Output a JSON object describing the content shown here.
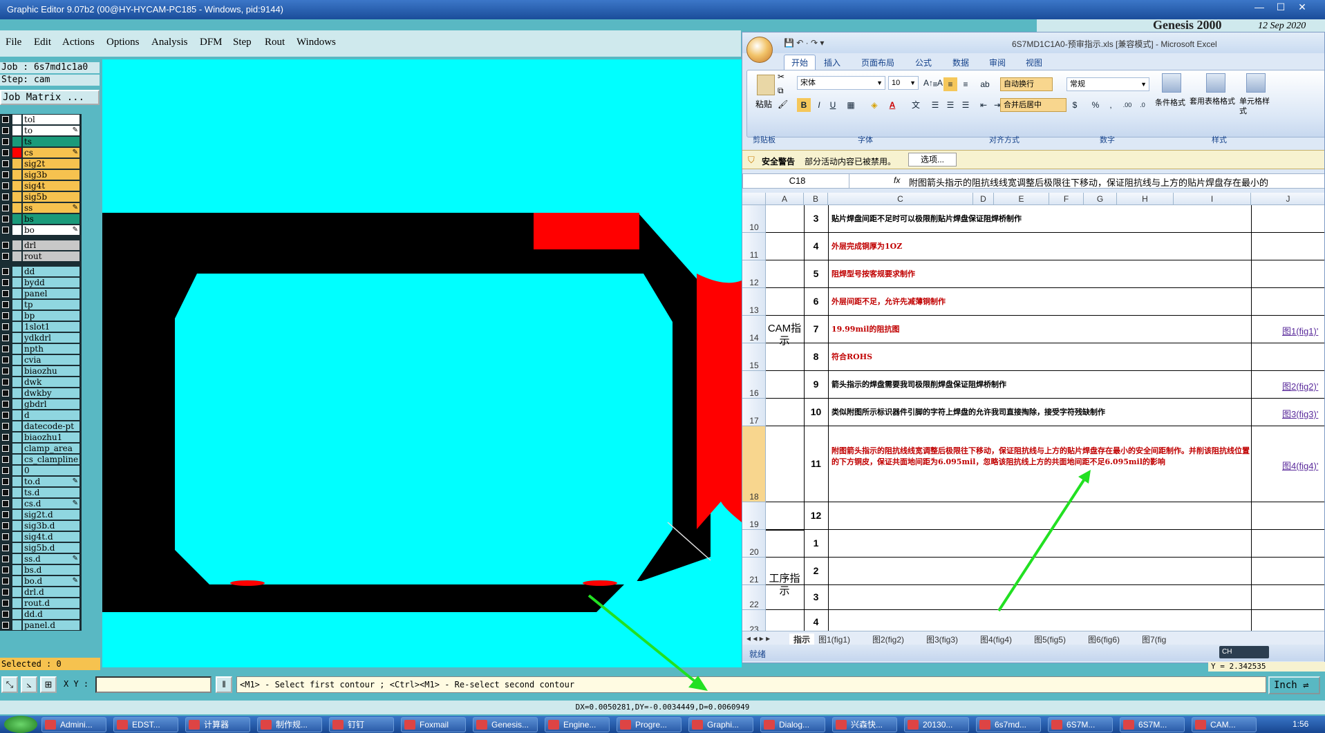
{
  "title_bar": {
    "title": "Graphic Editor 9.07b2 (00@HY-HYCAM-PC185 - Windows, pid:9144)"
  },
  "genesis": {
    "brand": "Genesis 2000",
    "date": "12 Sep 2020"
  },
  "menu": [
    "File",
    "Edit",
    "Actions",
    "Options",
    "Analysis",
    "DFM",
    "Step",
    "Rout",
    "Windows"
  ],
  "job": {
    "job_line": "Job : 6s7md1c1a0",
    "step_line": "Step: cam",
    "matrix_button": "Job Matrix ..."
  },
  "layers": [
    {
      "name": "tol",
      "color": "#ffffff",
      "bg": "#ffffff",
      "mark": ""
    },
    {
      "name": "to",
      "color": "#ffffff",
      "bg": "#ffffff",
      "mark": "✎"
    },
    {
      "name": "ts",
      "color": "#1a9a7a",
      "bg": "#1a9a7a",
      "mark": ""
    },
    {
      "name": "cs",
      "color": "#ff0000",
      "bg": "#f6c24f",
      "mark": "✎"
    },
    {
      "name": "sig2t",
      "color": "#f6c24f",
      "bg": "#f6c24f",
      "mark": ""
    },
    {
      "name": "sig3b",
      "color": "#f6c24f",
      "bg": "#f6c24f",
      "mark": ""
    },
    {
      "name": "sig4t",
      "color": "#f6c24f",
      "bg": "#f6c24f",
      "mark": ""
    },
    {
      "name": "sig5b",
      "color": "#f6c24f",
      "bg": "#f6c24f",
      "mark": ""
    },
    {
      "name": "ss",
      "color": "#f6c24f",
      "bg": "#f6c24f",
      "mark": "✎"
    },
    {
      "name": "bs",
      "color": "#1a9a7a",
      "bg": "#1a9a7a",
      "mark": ""
    },
    {
      "name": "bo",
      "color": "#ffffff",
      "bg": "#ffffff",
      "mark": "✎"
    },
    {
      "name": "drl",
      "color": "#c8c8c8",
      "bg": "#c8c8c8",
      "mark": ""
    },
    {
      "name": "rout",
      "color": "#c8c8c8",
      "bg": "#c8c8c8",
      "mark": ""
    },
    {
      "name": "dd",
      "color": "#8fd6e0",
      "bg": "#8fd6e0",
      "mark": ""
    },
    {
      "name": "bydd",
      "color": "#8fd6e0",
      "bg": "#8fd6e0",
      "mark": ""
    },
    {
      "name": "panel",
      "color": "#8fd6e0",
      "bg": "#8fd6e0",
      "mark": ""
    },
    {
      "name": "tp",
      "color": "#8fd6e0",
      "bg": "#8fd6e0",
      "mark": ""
    },
    {
      "name": "bp",
      "color": "#8fd6e0",
      "bg": "#8fd6e0",
      "mark": ""
    },
    {
      "name": "1slot1",
      "color": "#8fd6e0",
      "bg": "#8fd6e0",
      "mark": ""
    },
    {
      "name": "ydkdrl",
      "color": "#8fd6e0",
      "bg": "#8fd6e0",
      "mark": ""
    },
    {
      "name": "npth",
      "color": "#8fd6e0",
      "bg": "#8fd6e0",
      "mark": ""
    },
    {
      "name": "cvia",
      "color": "#8fd6e0",
      "bg": "#8fd6e0",
      "mark": ""
    },
    {
      "name": "biaozhu",
      "color": "#8fd6e0",
      "bg": "#8fd6e0",
      "mark": ""
    },
    {
      "name": "dwk",
      "color": "#8fd6e0",
      "bg": "#8fd6e0",
      "mark": ""
    },
    {
      "name": "dwkby",
      "color": "#8fd6e0",
      "bg": "#8fd6e0",
      "mark": ""
    },
    {
      "name": "gbdrl",
      "color": "#8fd6e0",
      "bg": "#8fd6e0",
      "mark": ""
    },
    {
      "name": "d",
      "color": "#8fd6e0",
      "bg": "#8fd6e0",
      "mark": ""
    },
    {
      "name": "datecode-pt",
      "color": "#8fd6e0",
      "bg": "#8fd6e0",
      "mark": ""
    },
    {
      "name": "biaozhu1",
      "color": "#8fd6e0",
      "bg": "#8fd6e0",
      "mark": ""
    },
    {
      "name": "clamp_area",
      "color": "#8fd6e0",
      "bg": "#8fd6e0",
      "mark": ""
    },
    {
      "name": "cs_clampline",
      "color": "#8fd6e0",
      "bg": "#8fd6e0",
      "mark": ""
    },
    {
      "name": "0",
      "color": "#8fd6e0",
      "bg": "#8fd6e0",
      "mark": ""
    },
    {
      "name": "to.d",
      "color": "#8fd6e0",
      "bg": "#8fd6e0",
      "mark": "✎"
    },
    {
      "name": "ts.d",
      "color": "#8fd6e0",
      "bg": "#8fd6e0",
      "mark": ""
    },
    {
      "name": "cs.d",
      "color": "#8fd6e0",
      "bg": "#8fd6e0",
      "mark": "✎"
    },
    {
      "name": "sig2t.d",
      "color": "#8fd6e0",
      "bg": "#8fd6e0",
      "mark": ""
    },
    {
      "name": "sig3b.d",
      "color": "#8fd6e0",
      "bg": "#8fd6e0",
      "mark": ""
    },
    {
      "name": "sig4t.d",
      "color": "#8fd6e0",
      "bg": "#8fd6e0",
      "mark": ""
    },
    {
      "name": "sig5b.d",
      "color": "#8fd6e0",
      "bg": "#8fd6e0",
      "mark": ""
    },
    {
      "name": "ss.d",
      "color": "#8fd6e0",
      "bg": "#8fd6e0",
      "mark": "✎"
    },
    {
      "name": "bs.d",
      "color": "#8fd6e0",
      "bg": "#8fd6e0",
      "mark": ""
    },
    {
      "name": "bo.d",
      "color": "#8fd6e0",
      "bg": "#8fd6e0",
      "mark": "✎"
    },
    {
      "name": "drl.d",
      "color": "#8fd6e0",
      "bg": "#8fd6e0",
      "mark": ""
    },
    {
      "name": "rout.d",
      "color": "#8fd6e0",
      "bg": "#8fd6e0",
      "mark": ""
    },
    {
      "name": "dd.d",
      "color": "#8fd6e0",
      "bg": "#8fd6e0",
      "mark": ""
    },
    {
      "name": "panel.d",
      "color": "#8fd6e0",
      "bg": "#8fd6e0",
      "mark": ""
    }
  ],
  "selected": "Selected : 0",
  "cmd": {
    "xy_label": "X Y :",
    "prompt": "<M1> - Select first contour ; <Ctrl><M1> - Re-select second contour",
    "units": "Inch"
  },
  "dx_line": "DX=0.0050281,DY=-0.0034449,D=0.0060949",
  "excel": {
    "title": "6S7MD1C1A0-预审指示.xls  [兼容模式] - Microsoft Excel",
    "tabs": [
      "开始",
      "插入",
      "页面布局",
      "公式",
      "数据",
      "审阅",
      "视图"
    ],
    "font_name": "宋体",
    "font_size": "10",
    "number_format": "常规",
    "paste": "粘贴",
    "wrap": "自动换行",
    "merge": "合并后居中",
    "cond_format": "条件格式",
    "table_format": "套用表格格式",
    "cell_style": "单元格样式",
    "groups": [
      "剪贴板",
      "字体",
      "对齐方式",
      "数字",
      "样式"
    ],
    "security_label": "安全警告",
    "security_text": "部分活动内容已被禁用。",
    "options_btn": "选项...",
    "cell_ref": "C18",
    "formula": "附图箭头指示的阻抗线线宽调整后极限往下移动，保证阻抗线与上方的贴片焊盘存在最小的",
    "columns": [
      "A",
      "B",
      "C",
      "D",
      "E",
      "F",
      "G",
      "H",
      "I",
      "J"
    ],
    "group_cam": "CAM指示",
    "group_process": "工序指示",
    "rows": [
      {
        "rn": "10",
        "num": "3",
        "text": "贴片焊盘间距不足时可以极限削贴片焊盘保证阻焊桥制作",
        "color": "#000",
        "link": ""
      },
      {
        "rn": "11",
        "num": "4",
        "text": "外层完成铜厚为1OZ",
        "color": "#c00000",
        "link": ""
      },
      {
        "rn": "12",
        "num": "5",
        "text": "阻焊型号按客规要求制作",
        "color": "#c00000",
        "link": ""
      },
      {
        "rn": "13",
        "num": "6",
        "text": "外层间距不足，允许先减薄铜制作",
        "color": "#c00000",
        "link": ""
      },
      {
        "rn": "14",
        "num": "7",
        "text": "19.99mil的阻抗图",
        "color": "#c00000",
        "link": "图1(fig1)'"
      },
      {
        "rn": "15",
        "num": "8",
        "text": "符合ROHS",
        "color": "#c00000",
        "link": ""
      },
      {
        "rn": "16",
        "num": "9",
        "text": "箭头指示的焊盘需要我司极限削焊盘保证阻焊桥制作",
        "color": "#000",
        "link": "图2(fig2)'"
      },
      {
        "rn": "17",
        "num": "10",
        "text": "类似附图所示标识器件引脚的字符上焊盘的允许我司直接掏除，接受字符残缺制作",
        "color": "#000",
        "link": "图3(fig3)'"
      },
      {
        "rn": "18",
        "num": "11",
        "text": "附图箭头指示的阻抗线线宽调整后极限往下移动，保证阻抗线与上方的贴片焊盘存在最小的安全间距制作。并削该阻抗线位置的下方铜皮，保证共面地间距为6.095mil，忽略该阻抗线上方的共面地间距不足6.095mil的影响",
        "color": "#c00000",
        "link": "图4(fig4)'"
      },
      {
        "rn": "19",
        "num": "12",
        "text": "",
        "color": "#000",
        "link": ""
      },
      {
        "rn": "20",
        "num": "1",
        "text": "",
        "color": "#000",
        "link": ""
      },
      {
        "rn": "21",
        "num": "2",
        "text": "",
        "color": "#000",
        "link": ""
      },
      {
        "rn": "22",
        "num": "3",
        "text": "",
        "color": "#000",
        "link": ""
      },
      {
        "rn": "23",
        "num": "4",
        "text": "",
        "color": "#000",
        "link": ""
      }
    ],
    "sheet_tabs": [
      "指示",
      "图1(fig1)",
      "图2(fig2)",
      "图3(fig3)",
      "图4(fig4)",
      "图5(fig5)",
      "图6(fig6)",
      "图7(fig"
    ],
    "status": "就绪",
    "ime": "CH"
  },
  "y_readout": "Y = 2.342535",
  "taskbar": [
    "Admini...",
    "EDST...",
    "计算器",
    "制作规...",
    "钉钉",
    "Foxmail",
    "Genesis...",
    "Engine...",
    "Progre...",
    "Graphi...",
    "Dialog...",
    "兴森快...",
    "20130...",
    "6s7md...",
    "6S7M...",
    "6S7M...",
    "CAM..."
  ],
  "clock": "1:56"
}
